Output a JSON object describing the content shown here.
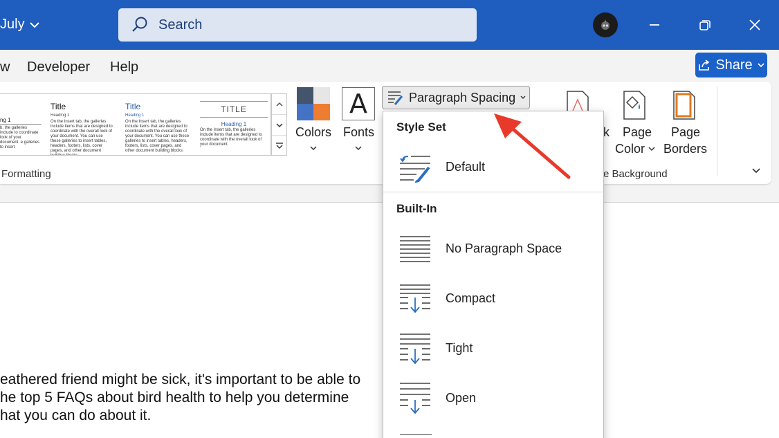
{
  "titlebar": {
    "doc_name": "July",
    "search_placeholder": "Search"
  },
  "tabs": [
    "w",
    "Developer",
    "Help"
  ],
  "share_label": "Share",
  "style_gallery": {
    "thumbs": [
      {
        "title": "",
        "heading": "ng 1",
        "body": "b, the galleries include to coordinate look of your document. e galleries to insert"
      },
      {
        "title": "Title",
        "heading": "Heading 1",
        "body": "On the Insert tab, the galleries include items that are designed to coordinate with the overall look of your document. You can use these galleries to insert tables, headers, footers, lists, cover pages, and other document building blocks."
      },
      {
        "title": "Title",
        "heading": "Heading 1",
        "body": "On the Insert tab, the galleries include items that are designed to coordinate with the overall look of your document. You can use these galleries to insert tables, headers, footers, lists, cover pages, and other document building blocks."
      },
      {
        "title": "TITLE",
        "heading": "Heading 1",
        "body": "On the Insert tab, the galleries include items that are designed to coordinate with the overall look of your document."
      }
    ],
    "group_label": "Formatting"
  },
  "design_buttons": {
    "colors_label": "Colors",
    "fonts_label": "Fonts",
    "fonts_glyph": "A",
    "paragraph_spacing_label": "Paragraph Spacing",
    "watermark_label": "k",
    "page_color_label_1": "Page",
    "page_color_label_2": "Color",
    "page_borders_label_1": "Page",
    "page_borders_label_2": "Borders",
    "page_background_group": "e Background"
  },
  "colors": {
    "accent": "#1f5dbf",
    "swatch_1": "#44546a",
    "swatch_2": "#e7e6e6",
    "swatch_3": "#4472c4",
    "swatch_4": "#ed7d31",
    "arrow": "#e8392b"
  },
  "dropdown": {
    "style_set_heading": "Style Set",
    "default_label": "Default",
    "built_in_heading": "Built-In",
    "items": [
      "No Paragraph Space",
      "Compact",
      "Tight",
      "Open"
    ]
  },
  "document": {
    "lines": [
      "eathered friend might be sick, it's important to be able to",
      "he top 5 FAQs about bird health to help you determine",
      "hat you can do about it."
    ]
  }
}
